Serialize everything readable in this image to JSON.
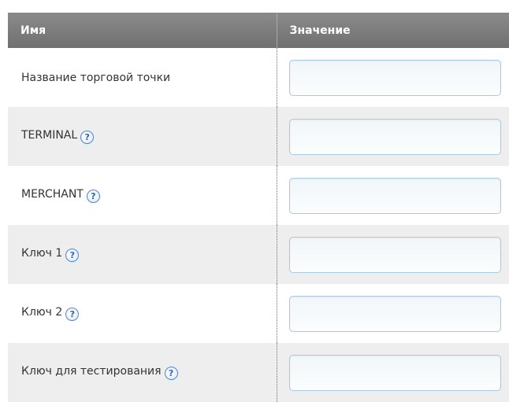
{
  "table": {
    "headers": {
      "name": "Имя",
      "value": "Значение"
    },
    "help_glyph": "?",
    "rows": [
      {
        "label": "Название торговой точки",
        "value": "",
        "help": false
      },
      {
        "label": "TERMINAL",
        "value": "",
        "help": true
      },
      {
        "label": "MERCHANT",
        "value": "",
        "help": true
      },
      {
        "label": "Ключ 1",
        "value": "",
        "help": true
      },
      {
        "label": "Ключ 2",
        "value": "",
        "help": true
      },
      {
        "label": "Ключ для тестирования",
        "value": "",
        "help": true
      }
    ]
  },
  "colors": {
    "header_bg": "#7d7d7d",
    "row_alt_bg": "#eeeeee",
    "input_border": "#a9c9df",
    "help_icon": "#4a86d6"
  }
}
